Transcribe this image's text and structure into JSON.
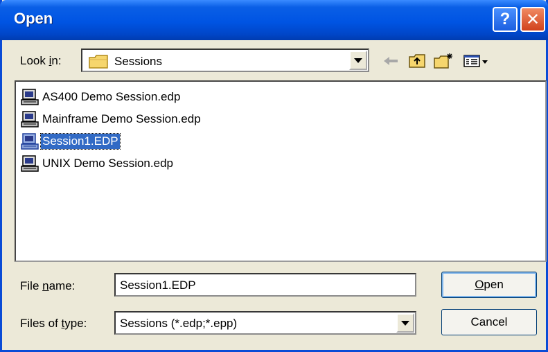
{
  "window": {
    "title": "Open",
    "help_glyph": "?",
    "close_glyph": "✕"
  },
  "look_in": {
    "label_pre": "Look ",
    "label_ul": "i",
    "label_post": "n:",
    "value": "Sessions",
    "icon": "folder-icon"
  },
  "toolbar": {
    "icons": [
      "back-arrow-icon",
      "up-folder-icon",
      "new-folder-icon",
      "view-menu-icon"
    ]
  },
  "files": [
    {
      "name": "AS400 Demo Session.edp",
      "icon": "session-file-icon",
      "selected": false
    },
    {
      "name": "Mainframe Demo Session.edp",
      "icon": "session-file-icon",
      "selected": false
    },
    {
      "name": "Session1.EDP",
      "icon": "session-file-icon",
      "selected": true
    },
    {
      "name": "UNIX Demo Session.edp",
      "icon": "session-file-icon",
      "selected": false
    }
  ],
  "file_name": {
    "label_pre": "File ",
    "label_ul": "n",
    "label_post": "ame:",
    "value": "Session1.EDP"
  },
  "file_type": {
    "label_pre": "Files of ",
    "label_ul": "t",
    "label_post": "ype:",
    "value": "Sessions (*.edp;*.epp)"
  },
  "buttons": {
    "open_ul": "O",
    "open_post": "pen",
    "cancel": "Cancel"
  },
  "colors": {
    "title_bar": "#0054e3",
    "selection": "#316ac5",
    "dialog_bg": "#ece9d8"
  }
}
